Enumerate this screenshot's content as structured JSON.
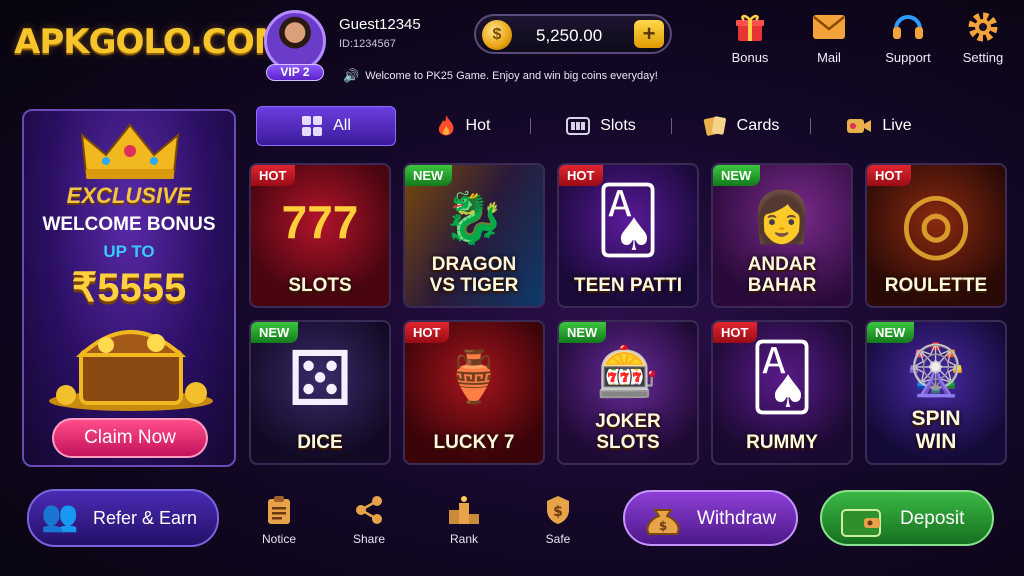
{
  "header": {
    "logo": "APKGOLO.COM",
    "user": {
      "name": "Guest12345",
      "id": "ID:1234567",
      "vip": "VIP 2"
    },
    "marquee": "Welcome to PK25 Game. Enjoy and win big coins everyday!",
    "balance": "5,250.00",
    "nav": [
      {
        "label": "Bonus",
        "icon": "gift-icon"
      },
      {
        "label": "Mail",
        "icon": "mail-icon"
      },
      {
        "label": "Support",
        "icon": "headset-icon"
      },
      {
        "label": "Setting",
        "icon": "gear-icon"
      }
    ]
  },
  "promo": {
    "line1": "EXCLUSIVE",
    "line2": "WELCOME BONUS",
    "line3": "UP TO",
    "amount": "₹5555",
    "button": "Claim Now"
  },
  "tabs": [
    {
      "label": "All",
      "icon": "grid-icon",
      "active": true
    },
    {
      "label": "Hot",
      "icon": "flame-icon"
    },
    {
      "label": "Slots",
      "icon": "slot-icon"
    },
    {
      "label": "Cards",
      "icon": "cards-icon"
    },
    {
      "label": "Live",
      "icon": "camera-icon"
    }
  ],
  "games": [
    {
      "tag": "HOT",
      "name": "SLOTS",
      "glyph": "777"
    },
    {
      "tag": "NEW",
      "name": "DRAGON VS TIGER",
      "glyph": "🐉"
    },
    {
      "tag": "HOT",
      "name": "TEEN PATTI",
      "glyph": "🂡"
    },
    {
      "tag": "NEW",
      "name": "ANDAR BAHAR",
      "glyph": "👩"
    },
    {
      "tag": "HOT",
      "name": "ROULETTE",
      "glyph": "◎"
    },
    {
      "tag": "NEW",
      "name": "DICE",
      "glyph": "⚄"
    },
    {
      "tag": "HOT",
      "name": "LUCKY 7",
      "glyph": "🏺"
    },
    {
      "tag": "NEW",
      "name": "JOKER SLOTS",
      "glyph": "🎰"
    },
    {
      "tag": "HOT",
      "name": "RUMMY",
      "glyph": "🂡"
    },
    {
      "tag": "NEW",
      "name": "SPIN WIN",
      "glyph": "🎡"
    }
  ],
  "bottom": {
    "refer": "Refer & Earn",
    "nav": [
      {
        "label": "Notice",
        "icon": "clipboard-icon"
      },
      {
        "label": "Share",
        "icon": "share-icon"
      },
      {
        "label": "Rank",
        "icon": "podium-icon"
      },
      {
        "label": "Safe",
        "icon": "safe-icon"
      }
    ],
    "withdraw": "Withdraw",
    "deposit": "Deposit"
  },
  "colors": {
    "gold": "#f7c52b",
    "hot": "#e0252f",
    "new": "#3bc63f",
    "purple": "#6b3ee0"
  }
}
